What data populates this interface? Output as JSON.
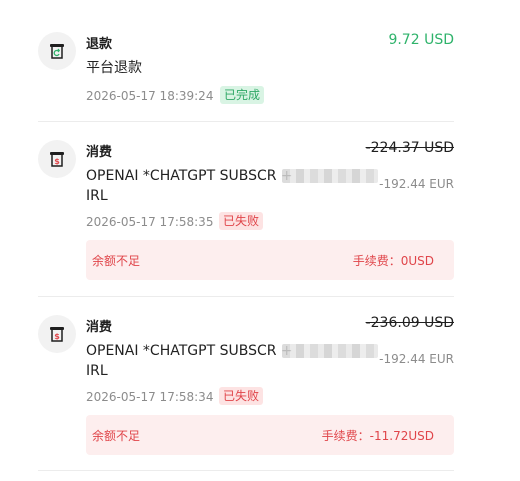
{
  "transactions": [
    {
      "type": "退款",
      "description": "平台退款",
      "amount": "9.72 USD",
      "date": "2026-05-17 18:39:24",
      "status": "已完成",
      "icon": "refund-icon"
    },
    {
      "type": "消费",
      "description_line1": "OPENAI *CHATGPT SUBSCR +",
      "description_line2": "IRL",
      "amount": "-224.37 USD",
      "amount_eur": "-192.44 EUR",
      "date": "2026-05-17 17:58:35",
      "status": "已失败",
      "error_reason": "余额不足",
      "fee": "手续费：0USD",
      "icon": "dollar-receipt-icon"
    },
    {
      "type": "消费",
      "description_line1": "OPENAI *CHATGPT SUBSCR +",
      "description_line2": "IRL",
      "amount": "-236.09 USD",
      "amount_eur": "-192.44 EUR",
      "date": "2026-05-17 17:58:34",
      "status": "已失败",
      "error_reason": "余额不足",
      "fee": "手续费：-11.72USD",
      "icon": "dollar-receipt-icon"
    }
  ],
  "colors": {
    "success_green": "#2fb36b",
    "error_red": "#e0454a",
    "error_bg": "#fdeeee"
  }
}
